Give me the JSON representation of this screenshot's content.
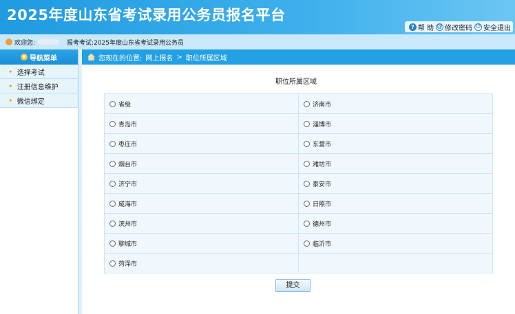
{
  "header": {
    "title": "2025年度山东省考试录用公务员报名平台",
    "links": {
      "help": "帮 助",
      "change_password": "修改密码",
      "logout": "安全退出"
    }
  },
  "userbar": {
    "welcome": "欢迎您:",
    "exam_label": "报考考试:",
    "exam_name": "2025年度山东省考试录用公务员"
  },
  "sidebar": {
    "header": "导航菜单",
    "items": [
      {
        "label": "选择考试"
      },
      {
        "label": "注册信息维护"
      },
      {
        "label": "微信绑定"
      }
    ]
  },
  "breadcrumb": {
    "prefix": "您现在的位置:",
    "parts": [
      "网上报名",
      ">",
      "职位所属区域"
    ]
  },
  "main": {
    "title": "职位所属区域",
    "options": [
      {
        "label": "省级"
      },
      {
        "label": "济南市"
      },
      {
        "label": "青岛市"
      },
      {
        "label": "淄博市"
      },
      {
        "label": "枣庄市"
      },
      {
        "label": "东营市"
      },
      {
        "label": "烟台市"
      },
      {
        "label": "潍坊市"
      },
      {
        "label": "济宁市"
      },
      {
        "label": "泰安市"
      },
      {
        "label": "威海市"
      },
      {
        "label": "日照市"
      },
      {
        "label": "滨州市"
      },
      {
        "label": "德州市"
      },
      {
        "label": "聊城市"
      },
      {
        "label": "临沂市"
      },
      {
        "label": "菏泽市"
      }
    ],
    "submit_label": "提交"
  }
}
